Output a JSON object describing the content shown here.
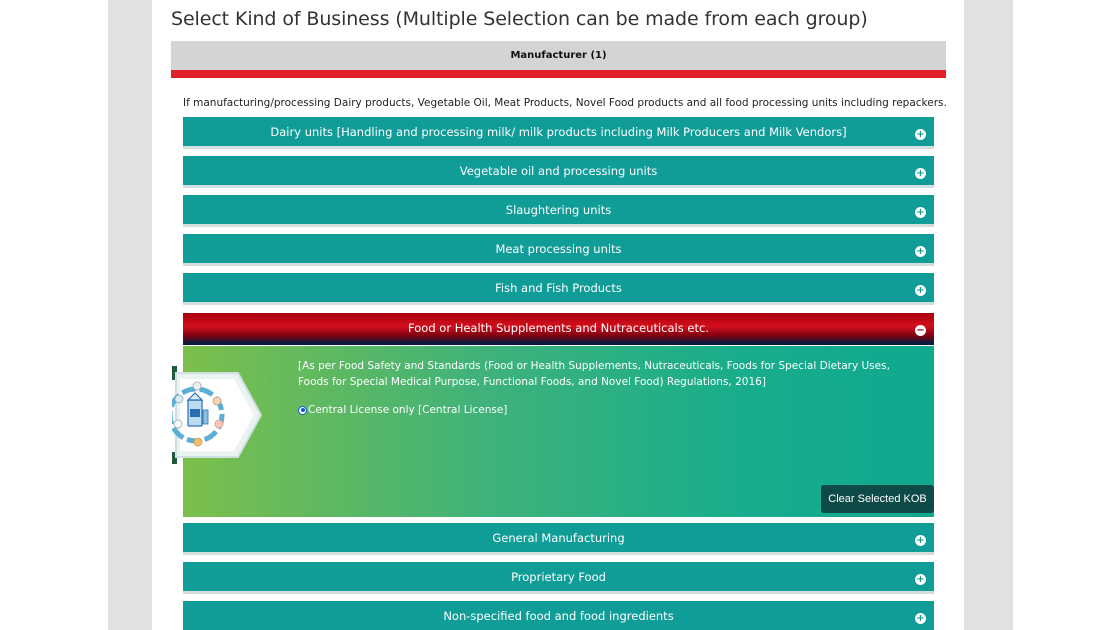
{
  "page": {
    "title": "Select Kind of Business (Multiple Selection can be made from each group)"
  },
  "group": {
    "label": "Manufacturer (1)",
    "intro": "If manufacturing/processing Dairy products, Vegetable Oil, Meat Products, Novel Food products and all food processing units including repackers."
  },
  "categories": [
    {
      "label": "Dairy units [Handling and processing milk/ milk products including Milk Producers and Milk Vendors]",
      "expanded": false,
      "icon": "plus-icon"
    },
    {
      "label": "Vegetable oil and processing units",
      "expanded": false,
      "icon": "plus-icon"
    },
    {
      "label": "Slaughtering units",
      "expanded": false,
      "icon": "plus-icon"
    },
    {
      "label": "Meat processing units",
      "expanded": false,
      "icon": "plus-icon"
    },
    {
      "label": "Fish and Fish Products",
      "expanded": false,
      "icon": "plus-icon"
    },
    {
      "label": "Food or Health Supplements and Nutraceuticals etc.",
      "expanded": true,
      "icon": "minus-icon"
    },
    {
      "label": "General Manufacturing",
      "expanded": false,
      "icon": "plus-icon"
    },
    {
      "label": "Proprietary Food",
      "expanded": false,
      "icon": "plus-icon"
    },
    {
      "label": "Non-specified food and food ingredients",
      "expanded": false,
      "icon": "plus-icon"
    }
  ],
  "expanded_panel": {
    "description": "[As per Food Safety and Standards (Food or Health Supplements, Nutraceuticals, Foods for Special Dietary Uses, Foods for Special Medical Purpose, Functional Foods, and Novel Food) Regulations, 2016]",
    "option_label": "Central License only [Central License]",
    "option_selected": true,
    "clear_button": "Clear Selected KOB"
  },
  "colors": {
    "accordion": "#109c97",
    "active_accordion": "#d30f1c",
    "red_bar": "#e0202a",
    "panel_gradient_start": "#7cbf4a",
    "panel_gradient_end": "#10a98f",
    "clear_button": "#0e4a48"
  }
}
